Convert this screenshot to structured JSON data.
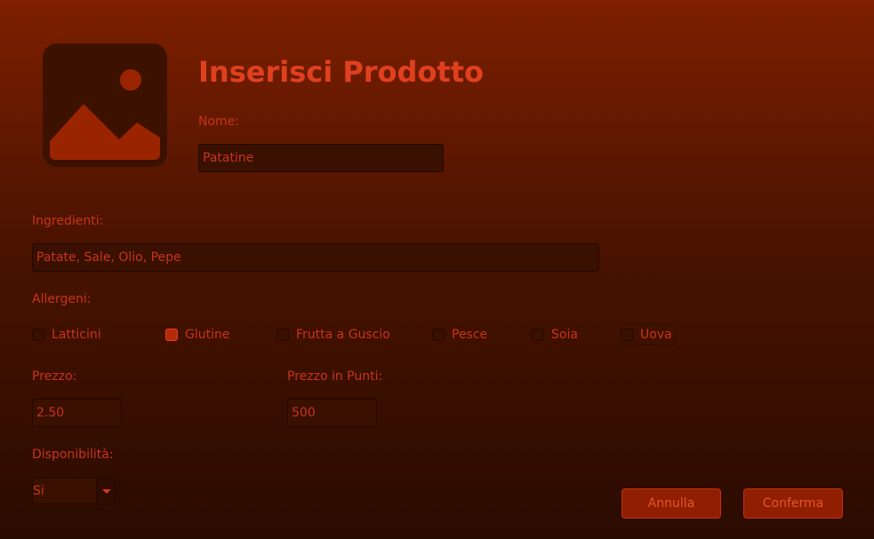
{
  "header": {
    "title": "Inserisci Prodotto",
    "image_icon": "image-placeholder-icon"
  },
  "form": {
    "name_label": "Nome:",
    "name_value": "Patatine",
    "ingredients_label": "Ingredienti:",
    "ingredients_value": "Patate, Sale, Olio, Pepe",
    "allergens_label": "Allergeni:",
    "allergens": [
      {
        "label": "Latticini",
        "checked": false
      },
      {
        "label": "Glutine",
        "checked": true
      },
      {
        "label": "Frutta a Guscio",
        "checked": false
      },
      {
        "label": "Pesce",
        "checked": false
      },
      {
        "label": "Soia",
        "checked": false
      },
      {
        "label": "Uova",
        "checked": false
      }
    ],
    "price_label": "Prezzo:",
    "price_value": "2.50",
    "points_label": "Prezzo in Punti:",
    "points_value": "500",
    "availability_label": "Disponibilità:",
    "availability_value": "Si"
  },
  "actions": {
    "cancel_label": "Annulla",
    "confirm_label": "Conferma"
  },
  "colors": {
    "accent": "#d2381a",
    "button_bg": "#8f1f00",
    "background_top": "#7e1f00",
    "background_bottom": "#2a0b00"
  }
}
